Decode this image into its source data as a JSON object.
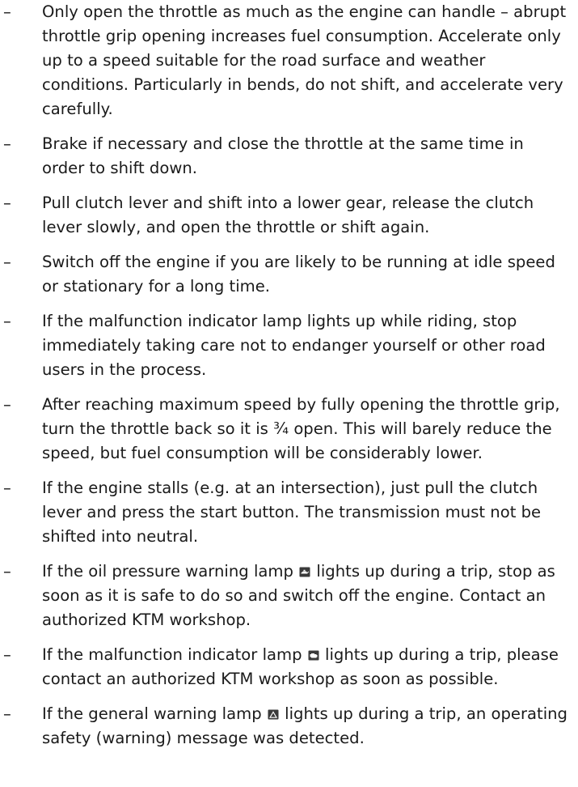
{
  "bullet_symbol": "–",
  "items": [
    {
      "text": "Only open the throttle as much as the engine can handle – abrupt throttle grip opening increases fuel consumption. Accelerate only up to a speed suitable for the road surface and weather conditions. Particularly in bends, do not shift, and accelerate very carefully."
    },
    {
      "text": "Brake if necessary and close the throttle at the same time in order to shift down."
    },
    {
      "text": "Pull clutch lever and shift into a lower gear, release the clutch lever slowly, and open the throttle or shift again."
    },
    {
      "text": "Switch off the engine if you are likely to be running at idle speed or stationary for a long time."
    },
    {
      "text": "If the malfunction indicator lamp lights up while riding, stop immediately taking care not to endanger yourself or other road users in the process."
    },
    {
      "text": "After reaching maximum speed by fully opening the throttle grip, turn the throttle back so it is ¾ open. This will barely reduce the speed, but fuel consumption will be considerably lower."
    },
    {
      "text": "If the engine stalls (e.g. at an intersection), just pull the clutch lever and press the start button. The transmission must not be shifted into neutral."
    },
    {
      "before": "If the oil pressure warning lamp",
      "icon": "oil-pressure-icon",
      "after": "lights up during a trip, stop as soon as it is safe to do so and switch off the engine. Contact an authorized KTM workshop."
    },
    {
      "before": "If the malfunction indicator lamp",
      "icon": "engine-malfunction-icon",
      "after": "lights up during a trip, please contact an authorized KTM workshop as soon as possible."
    },
    {
      "before": "If the general warning lamp",
      "icon": "general-warning-icon",
      "after": "lights up during a trip, an operating safety (warning) message was detected."
    }
  ]
}
